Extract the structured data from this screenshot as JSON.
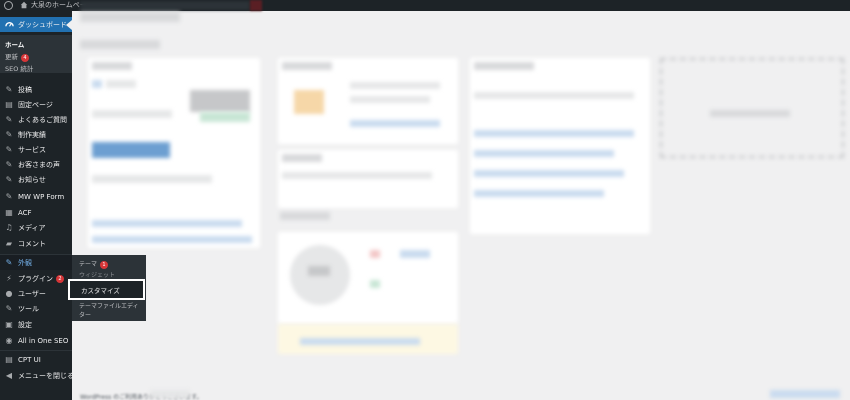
{
  "admin_bar": {
    "site_name": "大泉のホームペー",
    "colors": {
      "bar": "#1d2327",
      "text": "#c3c4c7"
    }
  },
  "sidebar": {
    "dashboard_label": "ダッシュボード",
    "sub_items": {
      "home": "ホーム",
      "updates": "更新",
      "updates_badge": "4",
      "seo_stats": "SEO 統計"
    },
    "items": [
      {
        "label": "投稿",
        "icon": "pin-icon"
      },
      {
        "label": "固定ページ",
        "icon": "page-icon"
      },
      {
        "label": "よくあるご質問",
        "icon": "pin-icon"
      },
      {
        "label": "制作実績",
        "icon": "pin-icon"
      },
      {
        "label": "サービス",
        "icon": "pin-icon"
      },
      {
        "label": "お客さまの声",
        "icon": "pin-icon"
      },
      {
        "label": "お知らせ",
        "icon": "pin-icon"
      },
      {
        "label": "MW WP Form",
        "icon": "pin-icon"
      },
      {
        "label": "ACF",
        "icon": "grid-icon"
      },
      {
        "label": "メディア",
        "icon": "media-icon"
      },
      {
        "label": "コメント",
        "icon": "comment-icon"
      },
      {
        "label": "外観",
        "icon": "brush-icon"
      },
      {
        "label": "プラグイン",
        "icon": "plugin-icon",
        "badge": "2"
      },
      {
        "label": "ユーザー",
        "icon": "user-icon"
      },
      {
        "label": "ツール",
        "icon": "wrench-icon"
      },
      {
        "label": "設定",
        "icon": "settings-icon"
      },
      {
        "label": "All in One SEO",
        "icon": "seo-icon"
      },
      {
        "label": "CPT UI",
        "icon": "cpt-icon"
      },
      {
        "label": "メニューを閉じる",
        "icon": "collapse-icon"
      }
    ],
    "colors": {
      "bg": "#1d2327",
      "active": "#2271b1",
      "appearance_text": "#72aee6"
    }
  },
  "flyout": {
    "theme": "テーマ",
    "theme_badge": "1",
    "widgets": "ウィジェット",
    "customize": "カスタマイズ",
    "theme_editor_line1": "テーマファイルエディ",
    "theme_editor_line2": "ター"
  },
  "footer": {
    "credit": "WordPress のご利用ありがとうございます。"
  }
}
